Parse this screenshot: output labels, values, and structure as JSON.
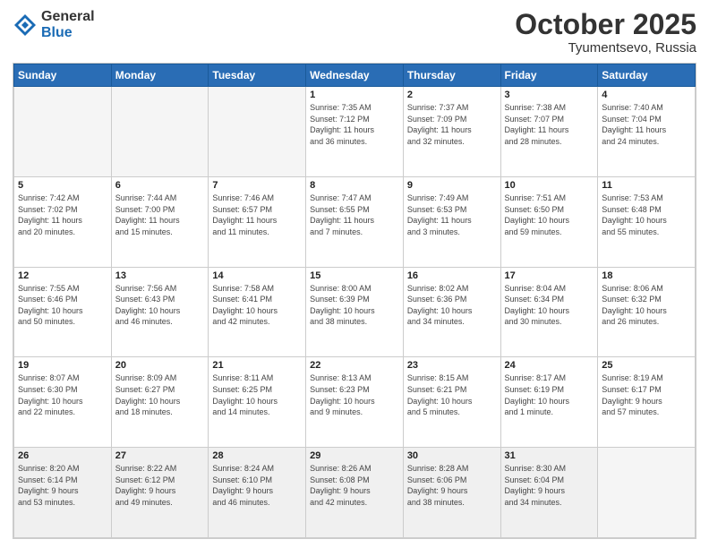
{
  "header": {
    "logo_general": "General",
    "logo_blue": "Blue",
    "month_title": "October 2025",
    "location": "Tyumentsevo, Russia"
  },
  "weekdays": [
    "Sunday",
    "Monday",
    "Tuesday",
    "Wednesday",
    "Thursday",
    "Friday",
    "Saturday"
  ],
  "weeks": [
    [
      {
        "day": "",
        "info": ""
      },
      {
        "day": "",
        "info": ""
      },
      {
        "day": "",
        "info": ""
      },
      {
        "day": "1",
        "info": "Sunrise: 7:35 AM\nSunset: 7:12 PM\nDaylight: 11 hours\nand 36 minutes."
      },
      {
        "day": "2",
        "info": "Sunrise: 7:37 AM\nSunset: 7:09 PM\nDaylight: 11 hours\nand 32 minutes."
      },
      {
        "day": "3",
        "info": "Sunrise: 7:38 AM\nSunset: 7:07 PM\nDaylight: 11 hours\nand 28 minutes."
      },
      {
        "day": "4",
        "info": "Sunrise: 7:40 AM\nSunset: 7:04 PM\nDaylight: 11 hours\nand 24 minutes."
      }
    ],
    [
      {
        "day": "5",
        "info": "Sunrise: 7:42 AM\nSunset: 7:02 PM\nDaylight: 11 hours\nand 20 minutes."
      },
      {
        "day": "6",
        "info": "Sunrise: 7:44 AM\nSunset: 7:00 PM\nDaylight: 11 hours\nand 15 minutes."
      },
      {
        "day": "7",
        "info": "Sunrise: 7:46 AM\nSunset: 6:57 PM\nDaylight: 11 hours\nand 11 minutes."
      },
      {
        "day": "8",
        "info": "Sunrise: 7:47 AM\nSunset: 6:55 PM\nDaylight: 11 hours\nand 7 minutes."
      },
      {
        "day": "9",
        "info": "Sunrise: 7:49 AM\nSunset: 6:53 PM\nDaylight: 11 hours\nand 3 minutes."
      },
      {
        "day": "10",
        "info": "Sunrise: 7:51 AM\nSunset: 6:50 PM\nDaylight: 10 hours\nand 59 minutes."
      },
      {
        "day": "11",
        "info": "Sunrise: 7:53 AM\nSunset: 6:48 PM\nDaylight: 10 hours\nand 55 minutes."
      }
    ],
    [
      {
        "day": "12",
        "info": "Sunrise: 7:55 AM\nSunset: 6:46 PM\nDaylight: 10 hours\nand 50 minutes."
      },
      {
        "day": "13",
        "info": "Sunrise: 7:56 AM\nSunset: 6:43 PM\nDaylight: 10 hours\nand 46 minutes."
      },
      {
        "day": "14",
        "info": "Sunrise: 7:58 AM\nSunset: 6:41 PM\nDaylight: 10 hours\nand 42 minutes."
      },
      {
        "day": "15",
        "info": "Sunrise: 8:00 AM\nSunset: 6:39 PM\nDaylight: 10 hours\nand 38 minutes."
      },
      {
        "day": "16",
        "info": "Sunrise: 8:02 AM\nSunset: 6:36 PM\nDaylight: 10 hours\nand 34 minutes."
      },
      {
        "day": "17",
        "info": "Sunrise: 8:04 AM\nSunset: 6:34 PM\nDaylight: 10 hours\nand 30 minutes."
      },
      {
        "day": "18",
        "info": "Sunrise: 8:06 AM\nSunset: 6:32 PM\nDaylight: 10 hours\nand 26 minutes."
      }
    ],
    [
      {
        "day": "19",
        "info": "Sunrise: 8:07 AM\nSunset: 6:30 PM\nDaylight: 10 hours\nand 22 minutes."
      },
      {
        "day": "20",
        "info": "Sunrise: 8:09 AM\nSunset: 6:27 PM\nDaylight: 10 hours\nand 18 minutes."
      },
      {
        "day": "21",
        "info": "Sunrise: 8:11 AM\nSunset: 6:25 PM\nDaylight: 10 hours\nand 14 minutes."
      },
      {
        "day": "22",
        "info": "Sunrise: 8:13 AM\nSunset: 6:23 PM\nDaylight: 10 hours\nand 9 minutes."
      },
      {
        "day": "23",
        "info": "Sunrise: 8:15 AM\nSunset: 6:21 PM\nDaylight: 10 hours\nand 5 minutes."
      },
      {
        "day": "24",
        "info": "Sunrise: 8:17 AM\nSunset: 6:19 PM\nDaylight: 10 hours\nand 1 minute."
      },
      {
        "day": "25",
        "info": "Sunrise: 8:19 AM\nSunset: 6:17 PM\nDaylight: 9 hours\nand 57 minutes."
      }
    ],
    [
      {
        "day": "26",
        "info": "Sunrise: 8:20 AM\nSunset: 6:14 PM\nDaylight: 9 hours\nand 53 minutes."
      },
      {
        "day": "27",
        "info": "Sunrise: 8:22 AM\nSunset: 6:12 PM\nDaylight: 9 hours\nand 49 minutes."
      },
      {
        "day": "28",
        "info": "Sunrise: 8:24 AM\nSunset: 6:10 PM\nDaylight: 9 hours\nand 46 minutes."
      },
      {
        "day": "29",
        "info": "Sunrise: 8:26 AM\nSunset: 6:08 PM\nDaylight: 9 hours\nand 42 minutes."
      },
      {
        "day": "30",
        "info": "Sunrise: 8:28 AM\nSunset: 6:06 PM\nDaylight: 9 hours\nand 38 minutes."
      },
      {
        "day": "31",
        "info": "Sunrise: 8:30 AM\nSunset: 6:04 PM\nDaylight: 9 hours\nand 34 minutes."
      },
      {
        "day": "",
        "info": ""
      }
    ]
  ]
}
